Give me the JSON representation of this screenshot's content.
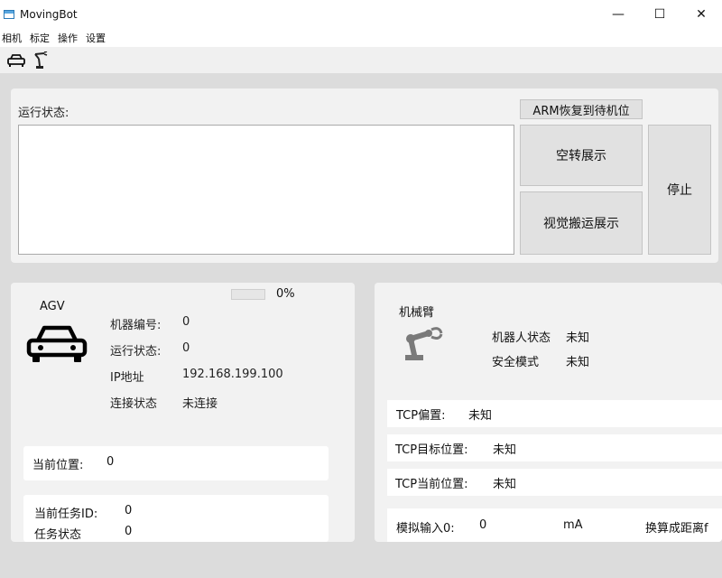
{
  "window": {
    "title": "MovingBot",
    "controls": {
      "minimize": "—",
      "maximize": "☐",
      "close": "✕"
    }
  },
  "menu": [
    "相机",
    "标定",
    "操作",
    "设置"
  ],
  "toolbar": {
    "icons": [
      "car-icon",
      "robot-arm-icon"
    ]
  },
  "status": {
    "label": "运行状态:",
    "log": "",
    "arm_reset_button": "ARM恢复到待机位",
    "idle_demo_button": "空转展示",
    "vision_demo_button": "视觉搬运展示",
    "stop_button": "停止"
  },
  "agv": {
    "title": "AGV",
    "progress_value": 0,
    "progress_text": "0%",
    "fields": [
      {
        "key": "机器编号:",
        "value": "0"
      },
      {
        "key": "运行状态:",
        "value": "0"
      },
      {
        "key": "IP地址",
        "value": "192.168.199.100"
      },
      {
        "key": "连接状态",
        "value": "未连接"
      }
    ],
    "position": {
      "key": "当前位置:",
      "value": "0"
    },
    "task": [
      {
        "key": "当前任务ID:",
        "value": "0"
      },
      {
        "key": "任务状态",
        "value": "0"
      }
    ]
  },
  "arm": {
    "title": "机械臂",
    "robot_state": {
      "key": "机器人状态",
      "value": "未知"
    },
    "safety_mode": {
      "key": "安全模式",
      "value": "未知"
    },
    "tcp_offset": {
      "key": "TCP偏置:",
      "value": "未知"
    },
    "tcp_target": {
      "key": "TCP目标位置:",
      "value": "未知"
    },
    "tcp_current": {
      "key": "TCP当前位置:",
      "value": "未知"
    },
    "analog": {
      "key": "模拟输入0:",
      "value": "0",
      "unit": "mA",
      "convert": "换算成距离f"
    }
  },
  "colors": {
    "progress": "#06b025",
    "panel": "#f2f2f2",
    "background": "#dcdcdc"
  }
}
